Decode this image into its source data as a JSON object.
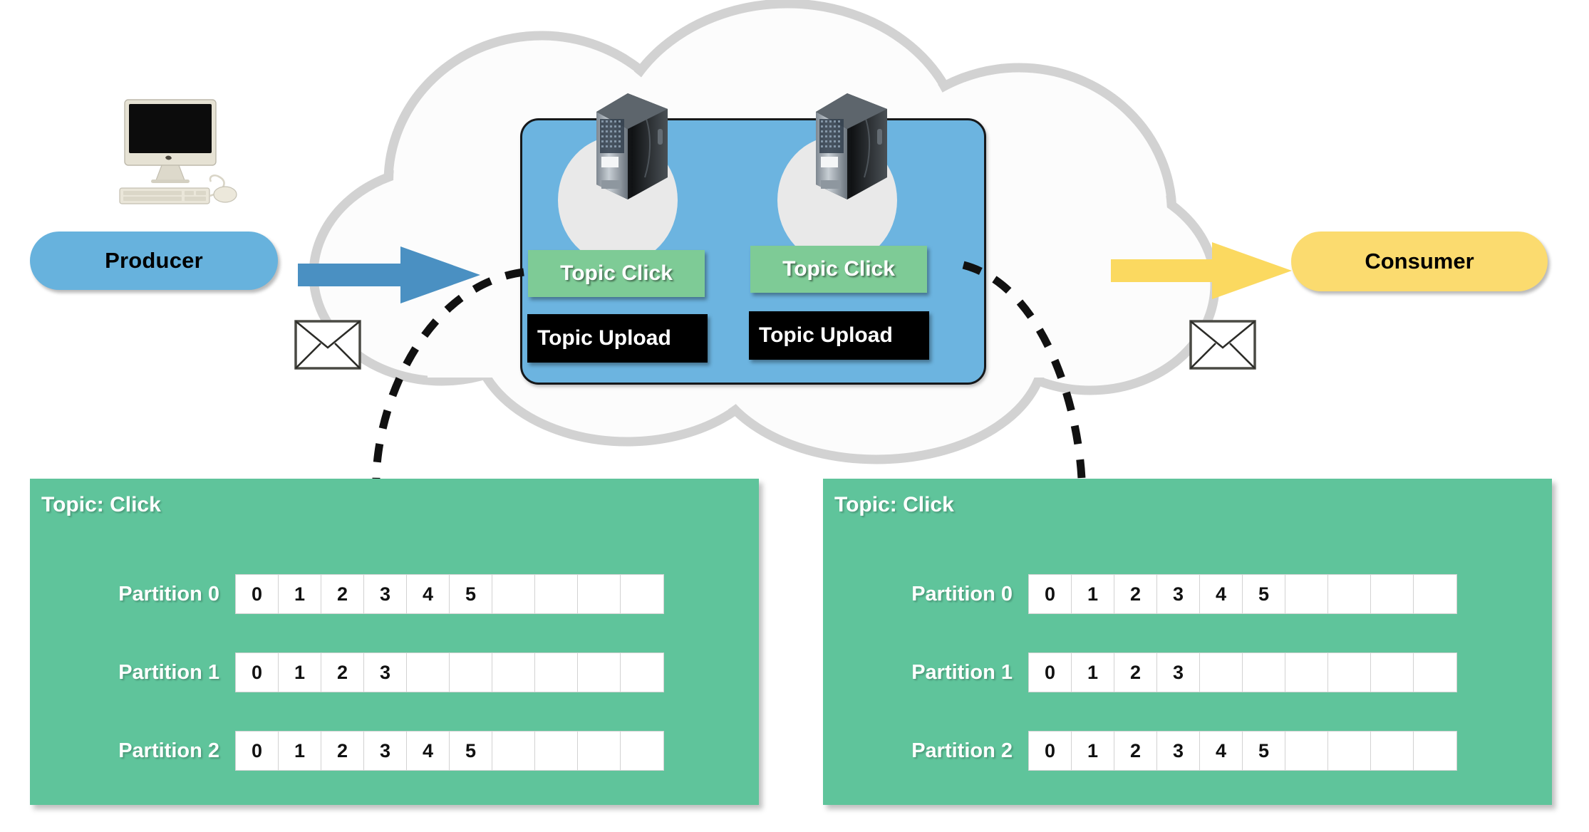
{
  "diagram": {
    "title": "Kafka producer consumer topic partition diagram",
    "colors": {
      "producer_pill": "#67b2dd",
      "consumer_pill": "#fbdb6f",
      "producer_arrow": "#4a90c2",
      "consumer_arrow": "#fbd960",
      "broker_box": "#6cb4e0",
      "topic_click_chip": "#7ecb96",
      "topic_upload_chip": "#000000",
      "topic_panel": "#5fc49b",
      "cloud_outline": "#d0d0d0",
      "cloud_fill": "#fbfbfb"
    }
  },
  "workstation": {
    "icon": "imac-computer-icon",
    "parts": [
      "monitor",
      "keyboard",
      "mouse"
    ]
  },
  "producer": {
    "label": "Producer",
    "arrow_icon": "right-arrow-icon",
    "envelope_icon": "envelope-icon"
  },
  "consumer": {
    "label": "Consumer",
    "arrow_icon": "right-arrow-icon",
    "envelope_icon": "envelope-icon"
  },
  "cloud": {
    "icon": "cloud-outline-icon"
  },
  "broker_cluster": {
    "brokers": [
      {
        "server_icon": "server-tower-icon",
        "topics": [
          {
            "label": "Topic Click",
            "style": "green"
          },
          {
            "label": "Topic Upload",
            "style": "black"
          }
        ]
      },
      {
        "server_icon": "server-tower-icon",
        "topics": [
          {
            "label": "Topic Click",
            "style": "green"
          },
          {
            "label": "Topic Upload",
            "style": "black"
          }
        ]
      }
    ]
  },
  "topic_panels": [
    {
      "title": "Topic: Click",
      "partitions": [
        {
          "label": "Partition 0",
          "offsets": [
            "0",
            "1",
            "2",
            "3",
            "4",
            "5"
          ],
          "total_cells": 10
        },
        {
          "label": "Partition 1",
          "offsets": [
            "0",
            "1",
            "2",
            "3"
          ],
          "total_cells": 10
        },
        {
          "label": "Partition 2",
          "offsets": [
            "0",
            "1",
            "2",
            "3",
            "4",
            "5"
          ],
          "total_cells": 10
        }
      ]
    },
    {
      "title": "Topic: Click",
      "partitions": [
        {
          "label": "Partition 0",
          "offsets": [
            "0",
            "1",
            "2",
            "3",
            "4",
            "5"
          ],
          "total_cells": 10
        },
        {
          "label": "Partition 1",
          "offsets": [
            "0",
            "1",
            "2",
            "3"
          ],
          "total_cells": 10
        },
        {
          "label": "Partition 2",
          "offsets": [
            "0",
            "1",
            "2",
            "3",
            "4",
            "5"
          ],
          "total_cells": 10
        }
      ]
    }
  ]
}
